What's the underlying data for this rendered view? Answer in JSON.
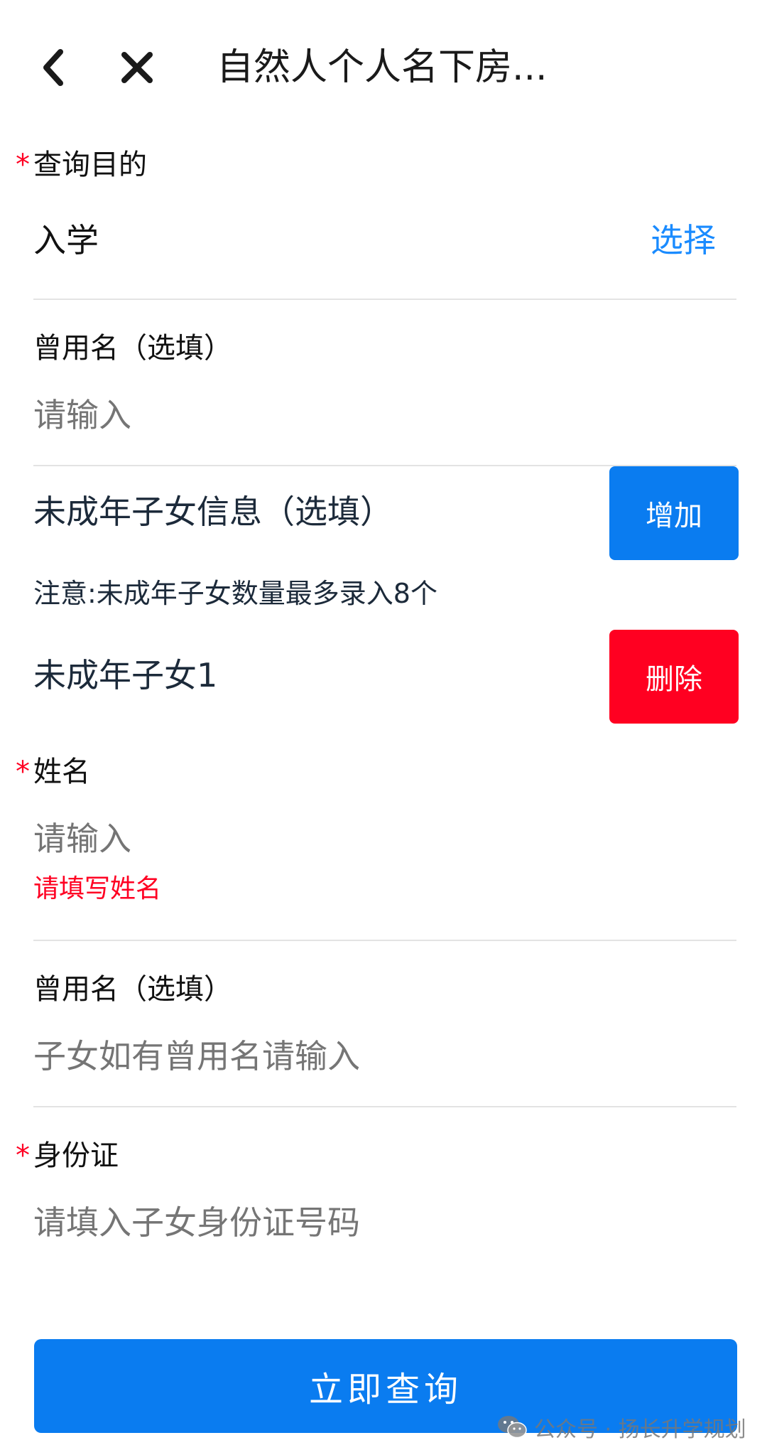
{
  "header": {
    "title": "自然人个人名下房...",
    "back_icon": "chevron-left-icon",
    "close_icon": "close-icon"
  },
  "purpose": {
    "required_mark": "*",
    "label": "查询目的",
    "value": "入学",
    "select_label": "选择"
  },
  "former_name": {
    "label": "曾用名（选填）",
    "placeholder": "请输入"
  },
  "children": {
    "title": "未成年子女信息（选填）",
    "add_label": "增加",
    "note": "注意:未成年子女数量最多录入8个",
    "child_title": "未成年子女1",
    "delete_label": "删除"
  },
  "child_name": {
    "required_mark": "*",
    "label": "姓名",
    "placeholder": "请输入",
    "error": "请填写姓名"
  },
  "child_former_name": {
    "label": "曾用名（选填）",
    "placeholder": "子女如有曾用名请输入"
  },
  "child_id": {
    "required_mark": "*",
    "label": "身份证",
    "placeholder": "请填入子女身份证号码"
  },
  "submit": {
    "label": "立即查询"
  },
  "watermark": {
    "text": "公众号 · 扬长升学规划",
    "icon": "wechat-icon"
  },
  "colors": {
    "primary": "#0a7cf0",
    "danger": "#ff0021",
    "link": "#1a8bff",
    "placeholder": "#c4c4c4"
  }
}
